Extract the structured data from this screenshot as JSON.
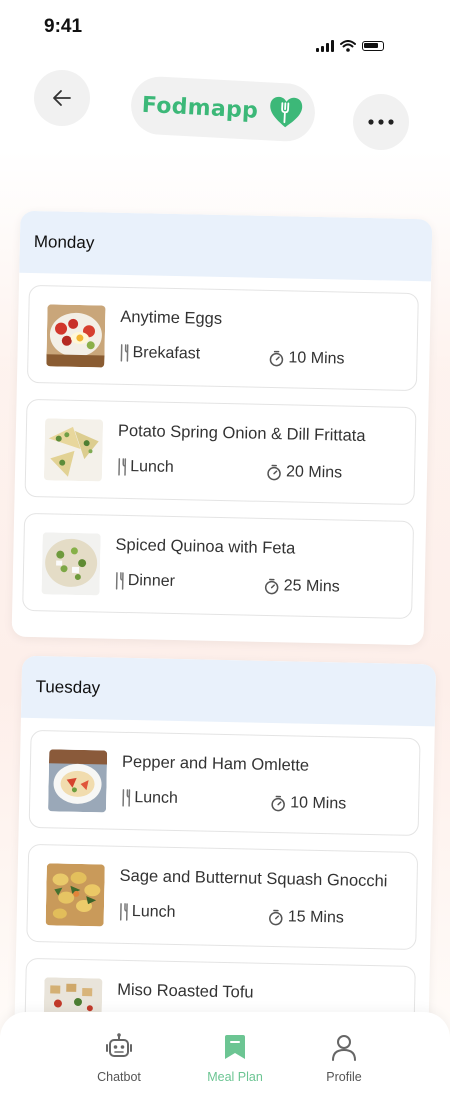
{
  "status": {
    "time": "9:41"
  },
  "header": {
    "app_name": "Fodmapp"
  },
  "days": [
    {
      "name": "Monday",
      "meals": [
        {
          "name": "Anytime Eggs",
          "type": "Brekafast",
          "time": "10 Mins"
        },
        {
          "name": "Potato Spring Onion & Dill Frittata",
          "type": "Lunch",
          "time": "20 Mins"
        },
        {
          "name": "Spiced Quinoa with Feta",
          "type": "Dinner",
          "time": "25 Mins"
        }
      ]
    },
    {
      "name": "Tuesday",
      "meals": [
        {
          "name": "Pepper and Ham Omlette",
          "type": "Lunch",
          "time": "10 Mins"
        },
        {
          "name": "Sage and Butternut Squash Gnocchi",
          "type": "Lunch",
          "time": "15 Mins"
        },
        {
          "name": "Miso Roasted Tofu"
        }
      ]
    }
  ],
  "nav": {
    "items": [
      {
        "label": "Chatbot",
        "icon": "robot-icon"
      },
      {
        "label": "Meal Plan",
        "icon": "bookmark-icon",
        "active": true
      },
      {
        "label": "Profile",
        "icon": "user-icon"
      }
    ]
  },
  "colors": {
    "brand_green": "#3cb878",
    "nav_active": "#6cc593",
    "day_header_bg": "#e9f1fb"
  }
}
